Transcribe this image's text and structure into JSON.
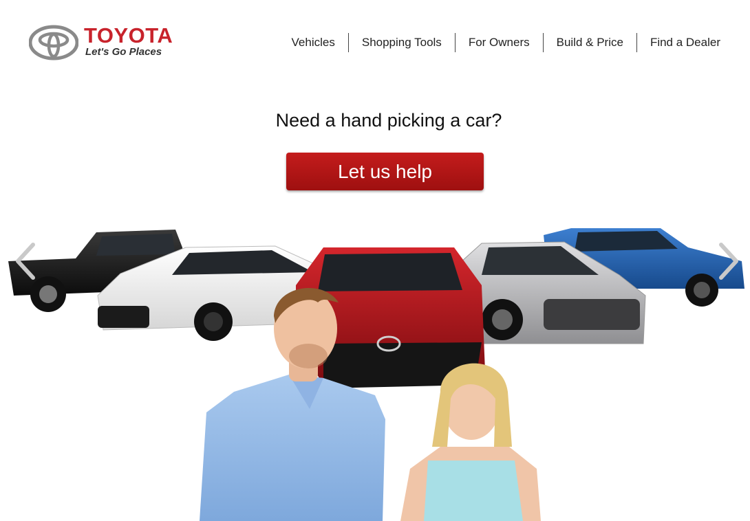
{
  "brand": {
    "name": "TOYOTA",
    "tagline": "Let's Go Places",
    "color": "#c8232c"
  },
  "nav": {
    "items": [
      {
        "label": "Vehicles"
      },
      {
        "label": "Shopping Tools"
      },
      {
        "label": "For Owners"
      },
      {
        "label": "Build & Price"
      },
      {
        "label": "Find a Dealer"
      }
    ]
  },
  "hero": {
    "headline": "Need a hand picking a car?",
    "cta_label": "Let us help",
    "cta_color": "#b01616"
  },
  "carousel": {
    "prev_icon": "chevron-left-icon",
    "next_icon": "chevron-right-icon",
    "vehicles": [
      {
        "color": "#1a1a1a"
      },
      {
        "color": "#f2f2f2"
      },
      {
        "color": "#b8141a"
      },
      {
        "color": "#b5b5b7"
      },
      {
        "color": "#1f5fae"
      }
    ]
  }
}
